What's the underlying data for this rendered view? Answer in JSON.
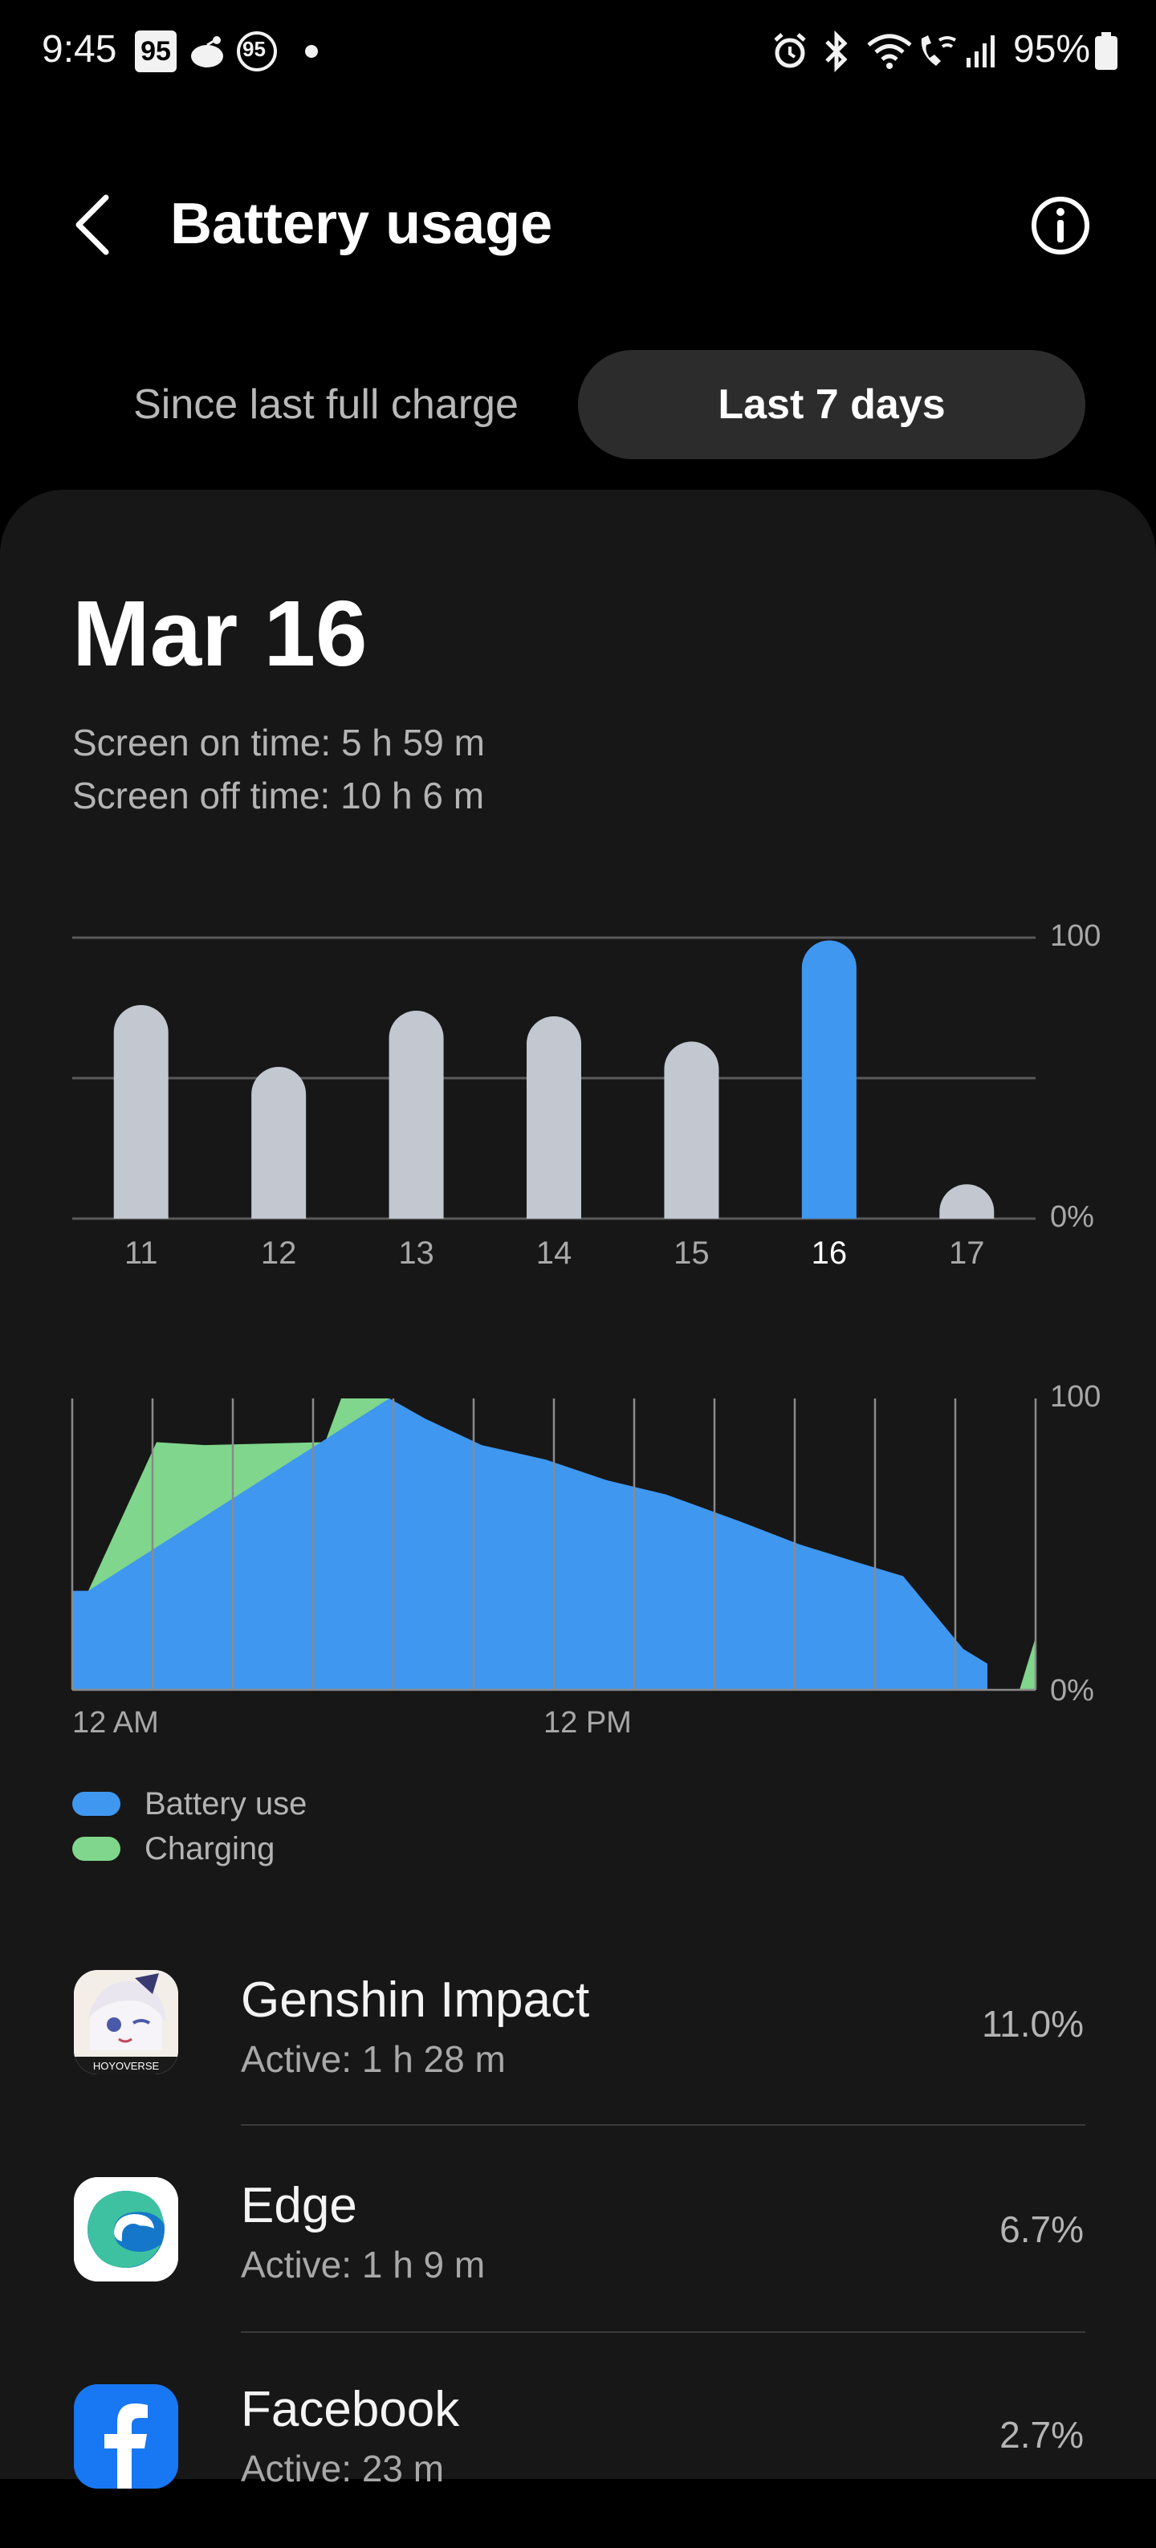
{
  "status_bar": {
    "time": "9:45",
    "notif_badge_1": "95",
    "notif_badge_2": "95",
    "battery_percent": "95%",
    "icons": [
      "square-badge-icon",
      "cat-icon",
      "circle-badge-icon",
      "dot-icon",
      "alarm-icon",
      "bluetooth-icon",
      "wifi-icon",
      "wifi-calling-icon",
      "signal-icon",
      "battery-icon"
    ]
  },
  "header": {
    "title": "Battery usage"
  },
  "tabs": {
    "since_full_charge": "Since last full charge",
    "last_7_days": "Last 7 days",
    "selected": "Last 7 days"
  },
  "summary": {
    "date": "Mar 16",
    "screen_on": "Screen on time: 5 h 59 m",
    "screen_off": "Screen off time: 10 h 6 m"
  },
  "colors": {
    "battery_use": "#3f97f0",
    "charging": "#7fd68c",
    "bar_default": "#c2c7d0",
    "selected_bar": "#3f97f0",
    "card_bg": "#171717"
  },
  "weekly_labels": {
    "y_top": "100",
    "y_bottom": "0%"
  },
  "daily_labels": {
    "y_top": "100",
    "y_bottom": "0%",
    "x_start": "12 AM",
    "x_mid": "12 PM"
  },
  "legend": {
    "battery_use": "Battery use",
    "charging": "Charging"
  },
  "chart_data": [
    {
      "type": "bar",
      "categories": [
        "11",
        "12",
        "13",
        "14",
        "15",
        "16",
        "17"
      ],
      "values": [
        76,
        54,
        74,
        72,
        63,
        99,
        5
      ],
      "selected": "16",
      "ylim": [
        0,
        100
      ],
      "y_ticks": [
        "0%",
        "100"
      ],
      "grid": true
    },
    {
      "type": "area",
      "x_labels": [
        "12 AM",
        "12 PM"
      ],
      "ylim": [
        0,
        100
      ],
      "y_ticks": [
        "0%",
        "100"
      ],
      "series": [
        {
          "name": "Charging",
          "x": [
            0.4,
            0.4,
            2.1,
            3.3,
            6.3,
            6.7,
            7.9,
            7.9
          ],
          "values": [
            0,
            34,
            85,
            84,
            85,
            100,
            100,
            0
          ]
        },
        {
          "name": "Battery use",
          "x": [
            0,
            0.4,
            7.9,
            8.8,
            10.2,
            11.8,
            13.3,
            14.8,
            16.6,
            18.1,
            19.5,
            20.7,
            21.6,
            22.2,
            22.8,
            22.8
          ],
          "values": [
            34,
            34,
            100,
            93,
            84,
            79,
            72,
            67,
            58,
            50,
            44,
            39,
            24,
            14,
            9,
            0
          ]
        },
        {
          "name": "Charging",
          "x": [
            23.6,
            24,
            24
          ],
          "values": [
            0,
            18,
            0
          ]
        }
      ],
      "grid": true
    }
  ],
  "apps": [
    {
      "name": "Genshin Impact",
      "active": "Active: 1 h 28 m",
      "percent": "11.0%",
      "icon": "genshin-impact-icon",
      "icon_caption": "HOYOVERSE"
    },
    {
      "name": "Edge",
      "active": "Active: 1 h 9 m",
      "percent": "6.7%",
      "icon": "edge-icon"
    },
    {
      "name": "Facebook",
      "active": "Active: 23 m",
      "percent": "2.7%",
      "icon": "facebook-icon"
    }
  ]
}
